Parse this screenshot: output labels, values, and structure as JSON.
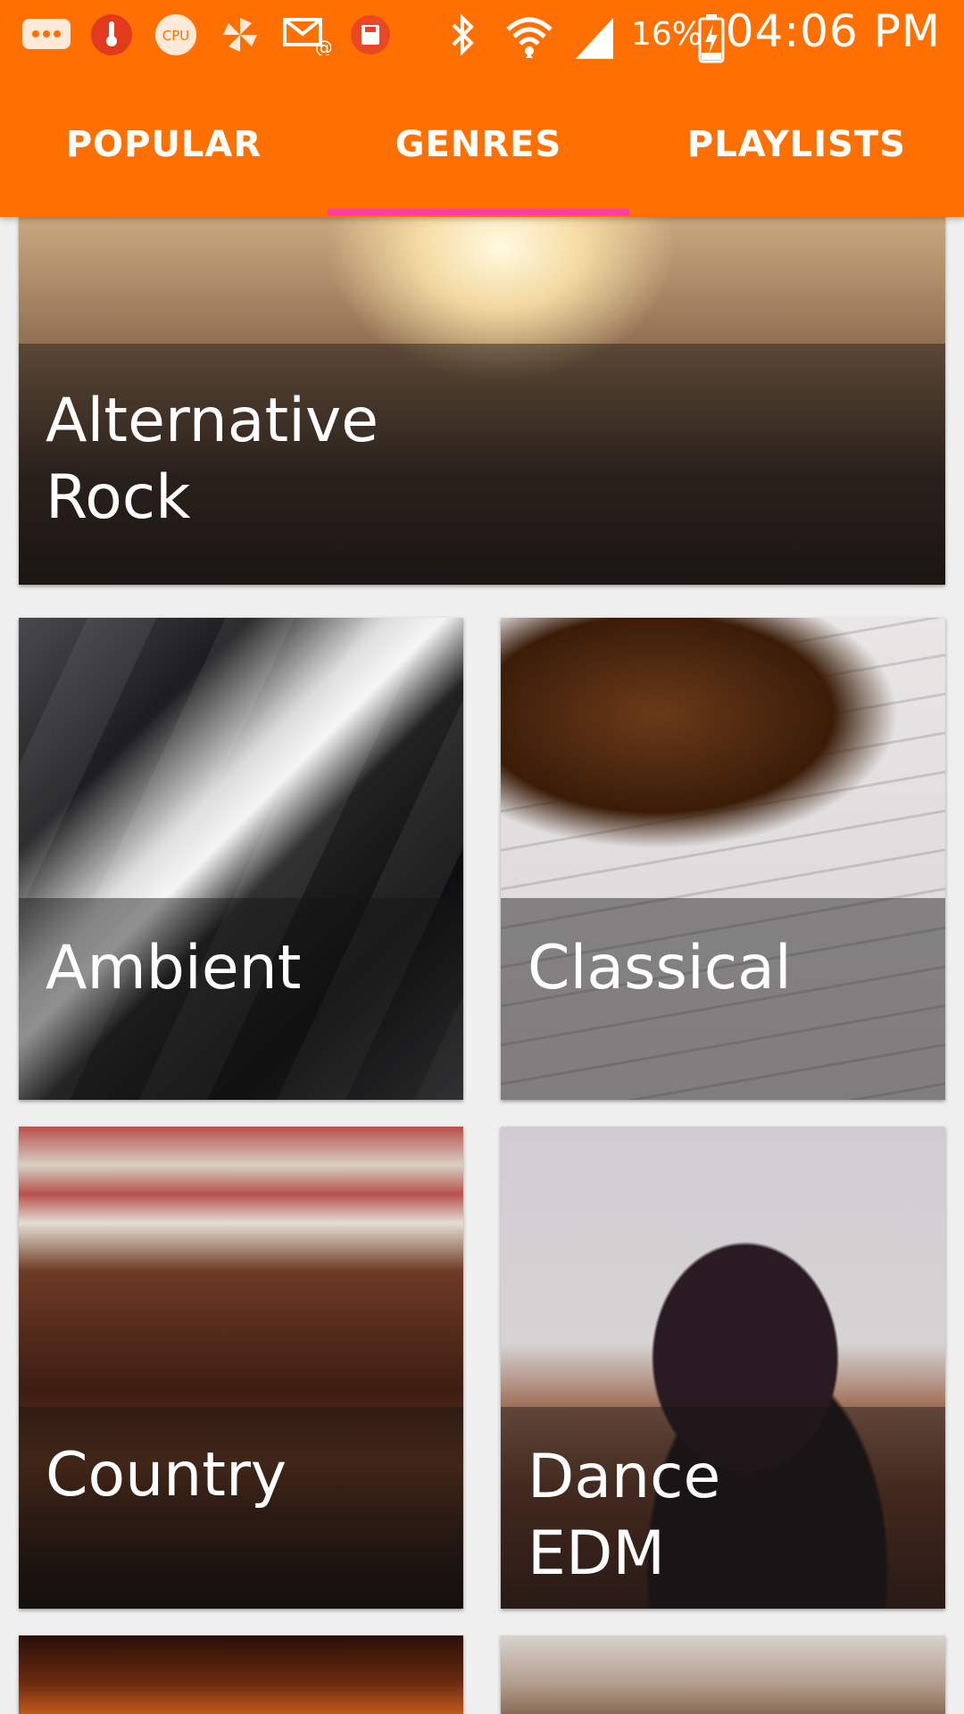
{
  "status_bar": {
    "battery_percent": "16%",
    "time": "04:06 PM",
    "icons": [
      "messages-icon",
      "temperature-icon",
      "cpu-icon",
      "pinwheel-icon",
      "email-icon",
      "save-icon",
      "bluetooth-icon",
      "wifi-icon",
      "signal-icon",
      "battery-charging-icon"
    ]
  },
  "tabs": [
    {
      "label": "POPULAR",
      "selected": false
    },
    {
      "label": "GENRES",
      "selected": true
    },
    {
      "label": "PLAYLISTS",
      "selected": false
    }
  ],
  "genres": [
    {
      "name": "Alternative\nRock"
    },
    {
      "name": "Ambient"
    },
    {
      "name": "Classical"
    },
    {
      "name": "Country"
    },
    {
      "name": "Dance\nEDM"
    }
  ],
  "colors": {
    "app_bar": "#ff7000",
    "tab_indicator": "#ff3ca0",
    "background": "#efefef"
  }
}
